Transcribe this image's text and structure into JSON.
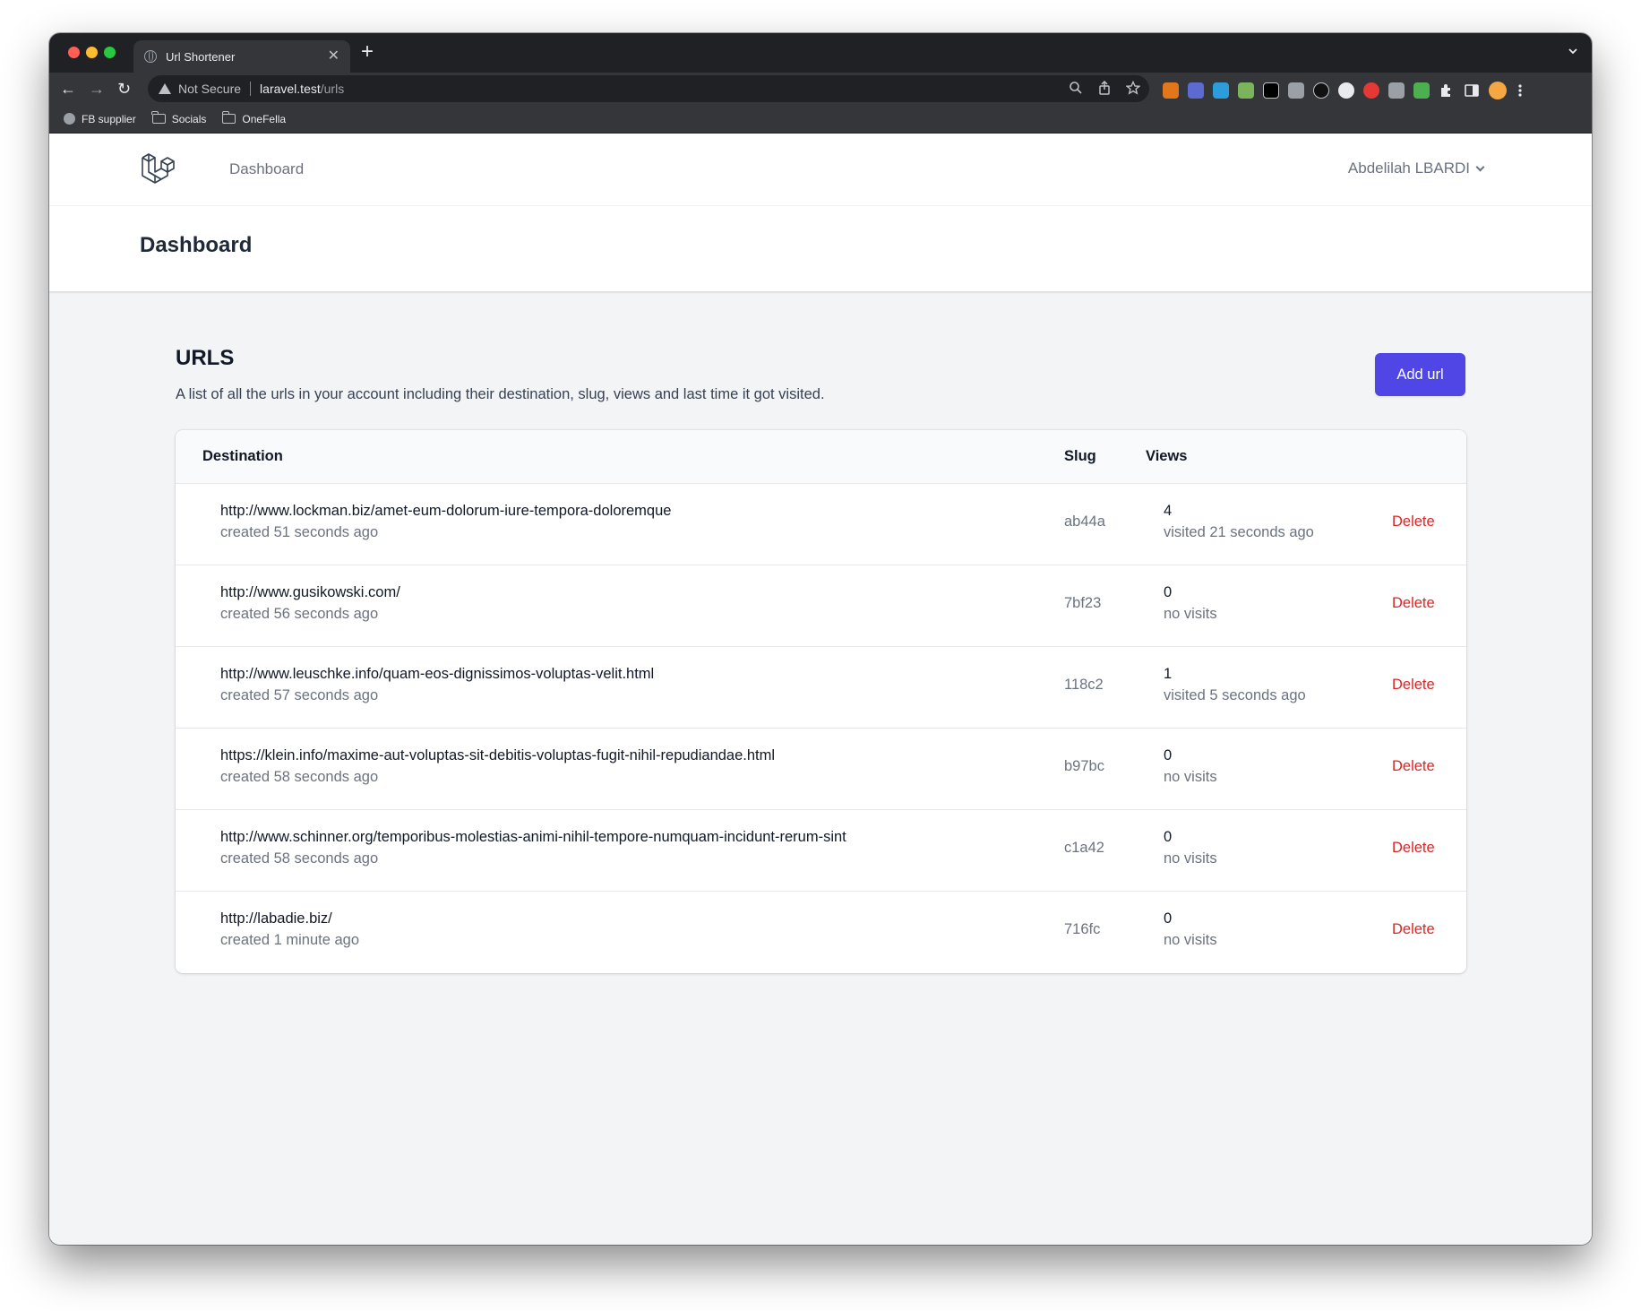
{
  "browser": {
    "tab_title": "Url Shortener",
    "security_label": "Not Secure",
    "url_host": "laravel.test",
    "url_path": "/urls",
    "bookmarks": [
      {
        "label": "FB supplier",
        "icon": "globe-icon"
      },
      {
        "label": "Socials",
        "icon": "folder-icon"
      },
      {
        "label": "OneFella",
        "icon": "folder-icon"
      }
    ]
  },
  "nav": {
    "dashboard_link": "Dashboard",
    "user_name": "Abdelilah LBARDI"
  },
  "header": {
    "title": "Dashboard"
  },
  "urls_section": {
    "title": "URLS",
    "description": "A list of all the urls in your account including their destination, slug, views and last time it got visited.",
    "add_button": "Add url",
    "columns": {
      "destination": "Destination",
      "slug": "Slug",
      "views": "Views"
    },
    "delete_label": "Delete",
    "rows": [
      {
        "url": "http://www.lockman.biz/amet-eum-dolorum-iure-tempora-doloremque",
        "created": "created 51 seconds ago",
        "slug": "ab44a",
        "views": "4",
        "last_visit": "visited 21 seconds ago"
      },
      {
        "url": "http://www.gusikowski.com/",
        "created": "created 56 seconds ago",
        "slug": "7bf23",
        "views": "0",
        "last_visit": "no visits"
      },
      {
        "url": "http://www.leuschke.info/quam-eos-dignissimos-voluptas-velit.html",
        "created": "created 57 seconds ago",
        "slug": "118c2",
        "views": "1",
        "last_visit": "visited 5 seconds ago"
      },
      {
        "url": "https://klein.info/maxime-aut-voluptas-sit-debitis-voluptas-fugit-nihil-repudiandae.html",
        "created": "created 58 seconds ago",
        "slug": "b97bc",
        "views": "0",
        "last_visit": "no visits"
      },
      {
        "url": "http://www.schinner.org/temporibus-molestias-animi-nihil-tempore-numquam-incidunt-rerum-sint",
        "created": "created 58 seconds ago",
        "slug": "c1a42",
        "views": "0",
        "last_visit": "no visits"
      },
      {
        "url": "http://labadie.biz/",
        "created": "created 1 minute ago",
        "slug": "716fc",
        "views": "0",
        "last_visit": "no visits"
      }
    ]
  },
  "colors": {
    "accent": "#4f46e5",
    "danger": "#dc2626"
  }
}
